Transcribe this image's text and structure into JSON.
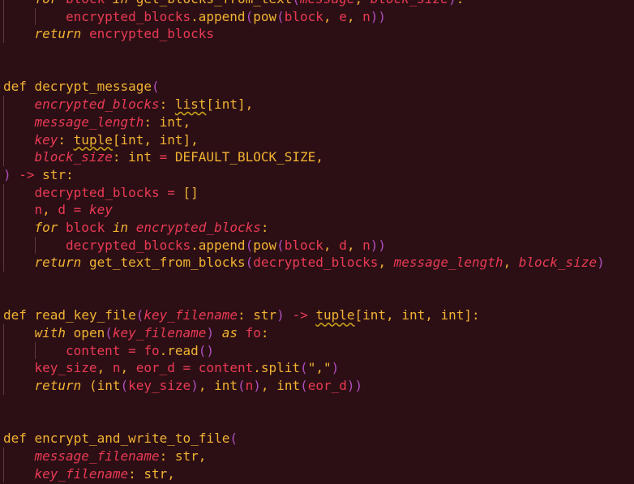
{
  "editor": {
    "language": "python",
    "lines": [
      {
        "indent": 1,
        "tokens": [
          {
            "t": "for ",
            "c": "kwi"
          },
          {
            "t": "block ",
            "c": "var"
          },
          {
            "t": "in ",
            "c": "kwi"
          },
          {
            "t": "get_blocks_from_text",
            "c": "fn"
          },
          {
            "t": "(",
            "c": "paren"
          },
          {
            "t": "message",
            "c": "param"
          },
          {
            "t": ", ",
            "c": "punc"
          },
          {
            "t": "block_size",
            "c": "param"
          },
          {
            "t": ")",
            "c": "paren"
          },
          {
            "t": ":",
            "c": "punc"
          }
        ]
      },
      {
        "indent": 2,
        "tokens": [
          {
            "t": "encrypted_blocks",
            "c": "var"
          },
          {
            "t": ".",
            "c": "punc"
          },
          {
            "t": "append",
            "c": "fn"
          },
          {
            "t": "(",
            "c": "paren"
          },
          {
            "t": "pow",
            "c": "fn"
          },
          {
            "t": "(",
            "c": "paren"
          },
          {
            "t": "block",
            "c": "var"
          },
          {
            "t": ", ",
            "c": "punc"
          },
          {
            "t": "e",
            "c": "var"
          },
          {
            "t": ", ",
            "c": "punc"
          },
          {
            "t": "n",
            "c": "var"
          },
          {
            "t": "))",
            "c": "paren"
          }
        ]
      },
      {
        "indent": 1,
        "tokens": [
          {
            "t": "return ",
            "c": "kwi"
          },
          {
            "t": "encrypted_blocks",
            "c": "var"
          }
        ]
      },
      {
        "indent": 0,
        "tokens": []
      },
      {
        "indent": 0,
        "tokens": []
      },
      {
        "indent": 0,
        "tokens": [
          {
            "t": "def ",
            "c": "kw"
          },
          {
            "t": "decrypt_message",
            "c": "fn"
          },
          {
            "t": "(",
            "c": "paren"
          }
        ]
      },
      {
        "indent": 1,
        "tokens": [
          {
            "t": "encrypted_blocks",
            "c": "param"
          },
          {
            "t": ": ",
            "c": "punc"
          },
          {
            "t": "list",
            "c": "type",
            "warn": true
          },
          {
            "t": "[int]",
            "c": "type"
          },
          {
            "t": ",",
            "c": "punc"
          }
        ]
      },
      {
        "indent": 1,
        "tokens": [
          {
            "t": "message_length",
            "c": "param"
          },
          {
            "t": ": ",
            "c": "punc"
          },
          {
            "t": "int",
            "c": "type"
          },
          {
            "t": ",",
            "c": "punc"
          }
        ]
      },
      {
        "indent": 1,
        "tokens": [
          {
            "t": "key",
            "c": "param"
          },
          {
            "t": ": ",
            "c": "punc"
          },
          {
            "t": "tuple",
            "c": "type",
            "warn": true
          },
          {
            "t": "[int, int]",
            "c": "type"
          },
          {
            "t": ",",
            "c": "punc"
          }
        ]
      },
      {
        "indent": 1,
        "tokens": [
          {
            "t": "block_size",
            "c": "param"
          },
          {
            "t": ": ",
            "c": "punc"
          },
          {
            "t": "int ",
            "c": "type"
          },
          {
            "t": "= ",
            "c": "op"
          },
          {
            "t": "DEFAULT_BLOCK_SIZE",
            "c": "const"
          },
          {
            "t": ",",
            "c": "punc"
          }
        ]
      },
      {
        "indent": 0,
        "tokens": [
          {
            "t": ")",
            "c": "paren"
          },
          {
            "t": " -> ",
            "c": "op"
          },
          {
            "t": "str",
            "c": "type"
          },
          {
            "t": ":",
            "c": "punc"
          }
        ]
      },
      {
        "indent": 1,
        "tokens": [
          {
            "t": "decrypted_blocks ",
            "c": "var"
          },
          {
            "t": "= ",
            "c": "op"
          },
          {
            "t": "[]",
            "c": "punc"
          }
        ]
      },
      {
        "indent": 1,
        "tokens": [
          {
            "t": "n",
            "c": "var"
          },
          {
            "t": ", ",
            "c": "punc"
          },
          {
            "t": "d ",
            "c": "var"
          },
          {
            "t": "= ",
            "c": "op"
          },
          {
            "t": "key",
            "c": "param"
          }
        ]
      },
      {
        "indent": 1,
        "tokens": [
          {
            "t": "for ",
            "c": "kwi"
          },
          {
            "t": "block ",
            "c": "var"
          },
          {
            "t": "in ",
            "c": "kwi"
          },
          {
            "t": "encrypted_blocks",
            "c": "param"
          },
          {
            "t": ":",
            "c": "punc"
          }
        ]
      },
      {
        "indent": 2,
        "tokens": [
          {
            "t": "decrypted_blocks",
            "c": "var"
          },
          {
            "t": ".",
            "c": "punc"
          },
          {
            "t": "append",
            "c": "fn"
          },
          {
            "t": "(",
            "c": "paren"
          },
          {
            "t": "pow",
            "c": "fn"
          },
          {
            "t": "(",
            "c": "paren"
          },
          {
            "t": "block",
            "c": "var"
          },
          {
            "t": ", ",
            "c": "punc"
          },
          {
            "t": "d",
            "c": "var"
          },
          {
            "t": ", ",
            "c": "punc"
          },
          {
            "t": "n",
            "c": "var"
          },
          {
            "t": "))",
            "c": "paren"
          }
        ]
      },
      {
        "indent": 1,
        "tokens": [
          {
            "t": "return ",
            "c": "kwi"
          },
          {
            "t": "get_text_from_blocks",
            "c": "fn"
          },
          {
            "t": "(",
            "c": "paren"
          },
          {
            "t": "decrypted_blocks",
            "c": "var"
          },
          {
            "t": ", ",
            "c": "punc"
          },
          {
            "t": "message_length",
            "c": "param"
          },
          {
            "t": ", ",
            "c": "punc"
          },
          {
            "t": "block_size",
            "c": "param"
          },
          {
            "t": ")",
            "c": "paren"
          }
        ]
      },
      {
        "indent": 0,
        "tokens": []
      },
      {
        "indent": 0,
        "tokens": []
      },
      {
        "indent": 0,
        "tokens": [
          {
            "t": "def ",
            "c": "kw"
          },
          {
            "t": "read_key_file",
            "c": "fn"
          },
          {
            "t": "(",
            "c": "paren"
          },
          {
            "t": "key_filename",
            "c": "param"
          },
          {
            "t": ": ",
            "c": "punc"
          },
          {
            "t": "str",
            "c": "type"
          },
          {
            "t": ")",
            "c": "paren"
          },
          {
            "t": " -> ",
            "c": "op"
          },
          {
            "t": "tuple",
            "c": "type",
            "warn": true
          },
          {
            "t": "[int, int, int]",
            "c": "type"
          },
          {
            "t": ":",
            "c": "punc"
          }
        ]
      },
      {
        "indent": 1,
        "tokens": [
          {
            "t": "with ",
            "c": "kwi"
          },
          {
            "t": "open",
            "c": "fn"
          },
          {
            "t": "(",
            "c": "paren"
          },
          {
            "t": "key_filename",
            "c": "param"
          },
          {
            "t": ")",
            "c": "paren"
          },
          {
            "t": " as ",
            "c": "kwi"
          },
          {
            "t": "fo",
            "c": "var"
          },
          {
            "t": ":",
            "c": "punc"
          }
        ]
      },
      {
        "indent": 2,
        "tokens": [
          {
            "t": "content ",
            "c": "var"
          },
          {
            "t": "= ",
            "c": "op"
          },
          {
            "t": "fo",
            "c": "var"
          },
          {
            "t": ".",
            "c": "punc"
          },
          {
            "t": "read",
            "c": "fn"
          },
          {
            "t": "()",
            "c": "paren"
          }
        ]
      },
      {
        "indent": 1,
        "tokens": [
          {
            "t": "key_size",
            "c": "var"
          },
          {
            "t": ", ",
            "c": "punc"
          },
          {
            "t": "n",
            "c": "var"
          },
          {
            "t": ", ",
            "c": "punc"
          },
          {
            "t": "eor_d ",
            "c": "var"
          },
          {
            "t": "= ",
            "c": "op"
          },
          {
            "t": "content",
            "c": "var"
          },
          {
            "t": ".",
            "c": "punc"
          },
          {
            "t": "split",
            "c": "fn"
          },
          {
            "t": "(",
            "c": "paren"
          },
          {
            "t": "\",\"",
            "c": "str"
          },
          {
            "t": ")",
            "c": "paren"
          }
        ]
      },
      {
        "indent": 1,
        "tokens": [
          {
            "t": "return ",
            "c": "kwi"
          },
          {
            "t": "(",
            "c": "punc"
          },
          {
            "t": "int",
            "c": "fn"
          },
          {
            "t": "(",
            "c": "paren"
          },
          {
            "t": "key_size",
            "c": "var"
          },
          {
            "t": ")",
            "c": "paren"
          },
          {
            "t": ", ",
            "c": "punc"
          },
          {
            "t": "int",
            "c": "fn"
          },
          {
            "t": "(",
            "c": "paren"
          },
          {
            "t": "n",
            "c": "var"
          },
          {
            "t": ")",
            "c": "paren"
          },
          {
            "t": ", ",
            "c": "punc"
          },
          {
            "t": "int",
            "c": "fn"
          },
          {
            "t": "(",
            "c": "paren"
          },
          {
            "t": "eor_d",
            "c": "var"
          },
          {
            "t": "))",
            "c": "paren"
          }
        ]
      },
      {
        "indent": 0,
        "tokens": []
      },
      {
        "indent": 0,
        "tokens": []
      },
      {
        "indent": 0,
        "tokens": [
          {
            "t": "def ",
            "c": "kw"
          },
          {
            "t": "encrypt_and_write_to_file",
            "c": "fn"
          },
          {
            "t": "(",
            "c": "paren"
          }
        ]
      },
      {
        "indent": 1,
        "tokens": [
          {
            "t": "message_filename",
            "c": "param"
          },
          {
            "t": ": ",
            "c": "punc"
          },
          {
            "t": "str",
            "c": "type"
          },
          {
            "t": ",",
            "c": "punc"
          }
        ]
      },
      {
        "indent": 1,
        "tokens": [
          {
            "t": "key_filename",
            "c": "param"
          },
          {
            "t": ": ",
            "c": "punc"
          },
          {
            "t": "str",
            "c": "type"
          },
          {
            "t": ",",
            "c": "punc"
          }
        ]
      }
    ]
  }
}
